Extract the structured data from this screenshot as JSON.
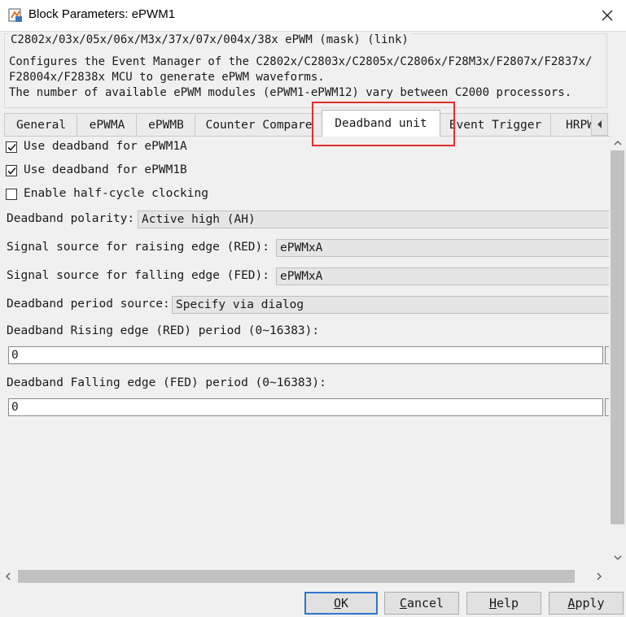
{
  "window": {
    "title": "Block Parameters: ePWM1",
    "app_icon": "simulink-block-icon",
    "close_icon": "close-icon"
  },
  "mask": {
    "title": "C2802x/03x/05x/06x/M3x/37x/07x/004x/38x ePWM (mask) (link)",
    "description_lines": [
      "Configures the Event Manager of the C2802x/C2803x/C2805x/C2806x/F28M3x/F2807x/F2837x/",
      "F28004x/F2838x MCU to generate ePWM waveforms.",
      "The number of available ePWM modules (ePWM1-ePWM12) vary between C2000 processors."
    ]
  },
  "tabs": [
    {
      "label": "General"
    },
    {
      "label": "ePWMA"
    },
    {
      "label": "ePWMB"
    },
    {
      "label": "Counter Compare"
    },
    {
      "label": "Deadband unit"
    },
    {
      "label": "Event Trigger"
    },
    {
      "label": "HRPWM"
    }
  ],
  "active_tab": "Deadband unit",
  "tab_scroll_icon": "chevron-left-icon",
  "highlight_color": "#e03030",
  "params": {
    "use_db_a": {
      "label": "Use deadband for ePWM1A",
      "checked": true
    },
    "use_db_b": {
      "label": "Use deadband for ePWM1B",
      "checked": true
    },
    "half_cycle": {
      "label": "Enable half-cycle clocking",
      "checked": false
    },
    "polarity": {
      "label": "Deadband polarity:",
      "value": "Active high (AH)"
    },
    "red_source": {
      "label": "Signal source for raising edge (RED):",
      "value": "ePWMxA"
    },
    "fed_source": {
      "label": "Signal source for falling edge (FED):",
      "value": "ePWMxA"
    },
    "period_source": {
      "label": "Deadband period source:",
      "value": "Specify via dialog"
    },
    "red_period": {
      "label": "Deadband Rising edge (RED) period (0~16383):",
      "value": "0"
    },
    "fed_period": {
      "label": "Deadband Falling edge (FED) period (0~16383):",
      "value": "0"
    }
  },
  "buttons": {
    "ok": {
      "mnemonic": "O",
      "rest": "K"
    },
    "cancel": {
      "mnemonic": "C",
      "rest": "ancel"
    },
    "help": {
      "mnemonic": "H",
      "rest": "elp"
    },
    "apply": {
      "mnemonic": "A",
      "rest": "pply"
    }
  },
  "colors": {
    "ok_border": "#2f76c9",
    "checkbox_check": "#1a1a1a"
  }
}
